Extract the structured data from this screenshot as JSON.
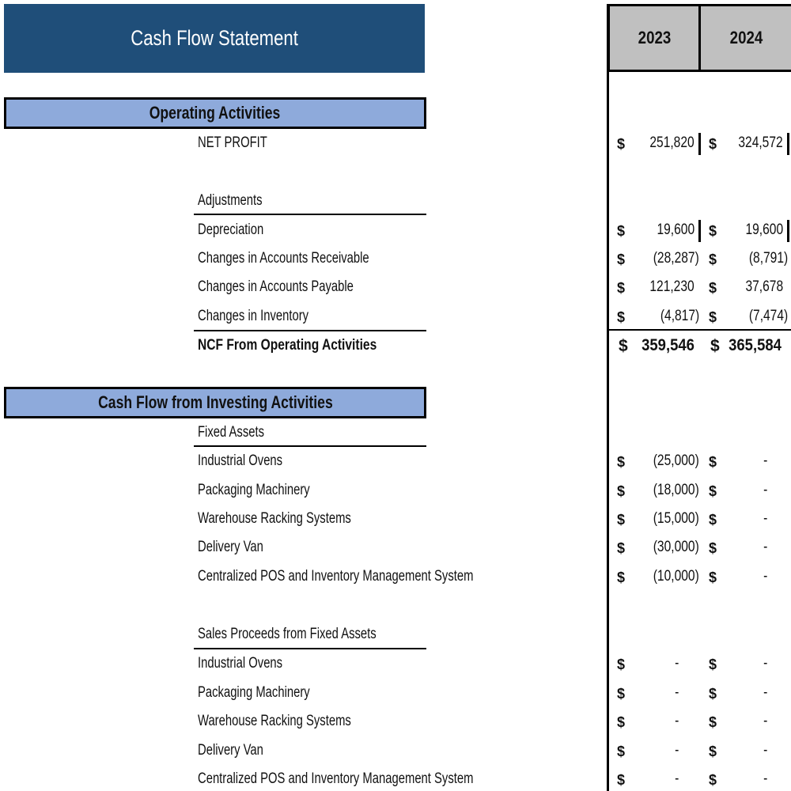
{
  "title": "Cash Flow Statement",
  "years": [
    "2023",
    "2024"
  ],
  "currency_symbol": "$",
  "colors": {
    "title_bg": "#1f4e79",
    "section_bg": "#8eaadb",
    "year_header_bg": "#c0c0c0"
  },
  "operating": {
    "header": "Operating Activities",
    "net_profit": {
      "label": "NET PROFIT",
      "values": [
        "251,820",
        "324,572"
      ]
    },
    "adjustments_label": "Adjustments",
    "rows": [
      {
        "label": "Depreciation",
        "values": [
          "19,600",
          "19,600"
        ]
      },
      {
        "label": "Changes in Accounts Receivable",
        "values": [
          "(28,287)",
          "(8,791)"
        ]
      },
      {
        "label": "Changes in Accounts Payable",
        "values": [
          "121,230",
          "37,678"
        ]
      },
      {
        "label": "Changes in Inventory",
        "values": [
          "(4,817)",
          "(7,474)"
        ]
      }
    ],
    "total": {
      "label": "NCF From Operating Activities",
      "values": [
        "359,546",
        "365,584"
      ]
    }
  },
  "investing": {
    "header": "Cash Flow from Investing Activities",
    "fixed_assets_label": "Fixed Assets",
    "fixed_assets": [
      {
        "label": "Industrial Ovens",
        "values": [
          "(25,000)",
          "-"
        ]
      },
      {
        "label": "Packaging Machinery",
        "values": [
          "(18,000)",
          "-"
        ]
      },
      {
        "label": "Warehouse Racking Systems",
        "values": [
          "(15,000)",
          "-"
        ]
      },
      {
        "label": "Delivery Van",
        "values": [
          "(30,000)",
          "-"
        ]
      },
      {
        "label": "Centralized POS and Inventory Management System",
        "values": [
          "(10,000)",
          "-"
        ]
      }
    ],
    "sales_proceeds_label": "Sales Proceeds from Fixed Assets",
    "sales_proceeds": [
      {
        "label": "Industrial Ovens",
        "values": [
          "-",
          "-"
        ]
      },
      {
        "label": "Packaging Machinery",
        "values": [
          "-",
          "-"
        ]
      },
      {
        "label": "Warehouse Racking Systems",
        "values": [
          "-",
          "-"
        ]
      },
      {
        "label": "Delivery Van",
        "values": [
          "-",
          "-"
        ]
      },
      {
        "label": "Centralized POS and Inventory Management System",
        "values": [
          "-",
          "-"
        ]
      }
    ]
  }
}
